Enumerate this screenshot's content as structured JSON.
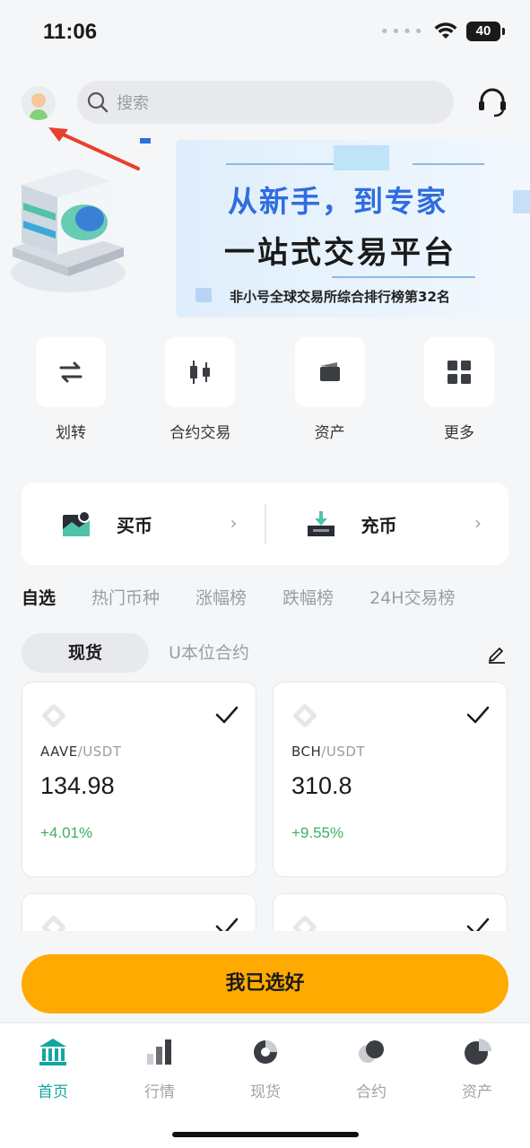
{
  "status_bar": {
    "time": "11:06",
    "battery": "40"
  },
  "header": {
    "search_placeholder": "搜索"
  },
  "banner": {
    "title_line1": "从新手，到专家",
    "title_line2": "一站式交易平台",
    "subtitle": "非小号全球交易所综合排行榜第32名"
  },
  "quick_actions": [
    {
      "label": "划转",
      "icon": "transfer-icon"
    },
    {
      "label": "合约交易",
      "icon": "candlestick-icon"
    },
    {
      "label": "资产",
      "icon": "wallet-icon"
    },
    {
      "label": "更多",
      "icon": "grid-icon"
    }
  ],
  "buy_card": {
    "buy_label": "买币",
    "deposit_label": "充币"
  },
  "market_tabs": [
    "自选",
    "热门币种",
    "涨幅榜",
    "跌幅榜",
    "24H交易榜"
  ],
  "sub_tabs": {
    "spot": "现货",
    "usdt_futures": "U本位合约"
  },
  "watchlist": [
    {
      "base": "AAVE",
      "quote": "/USDT",
      "price": "134.98",
      "change": "+4.01%"
    },
    {
      "base": "BCH",
      "quote": "/USDT",
      "price": "310.8",
      "change": "+9.55%"
    }
  ],
  "confirm_button": "我已选好",
  "bottom_nav": [
    {
      "label": "首页",
      "icon": "home-icon"
    },
    {
      "label": "行情",
      "icon": "market-icon"
    },
    {
      "label": "现货",
      "icon": "spot-icon"
    },
    {
      "label": "合约",
      "icon": "futures-icon"
    },
    {
      "label": "资产",
      "icon": "assets-icon"
    }
  ],
  "colors": {
    "accent": "#ffaa00",
    "active_nav": "#14a6a0",
    "positive": "#3fae5e",
    "banner_title": "#2f6de0",
    "annotation_arrow": "#e8402e"
  }
}
